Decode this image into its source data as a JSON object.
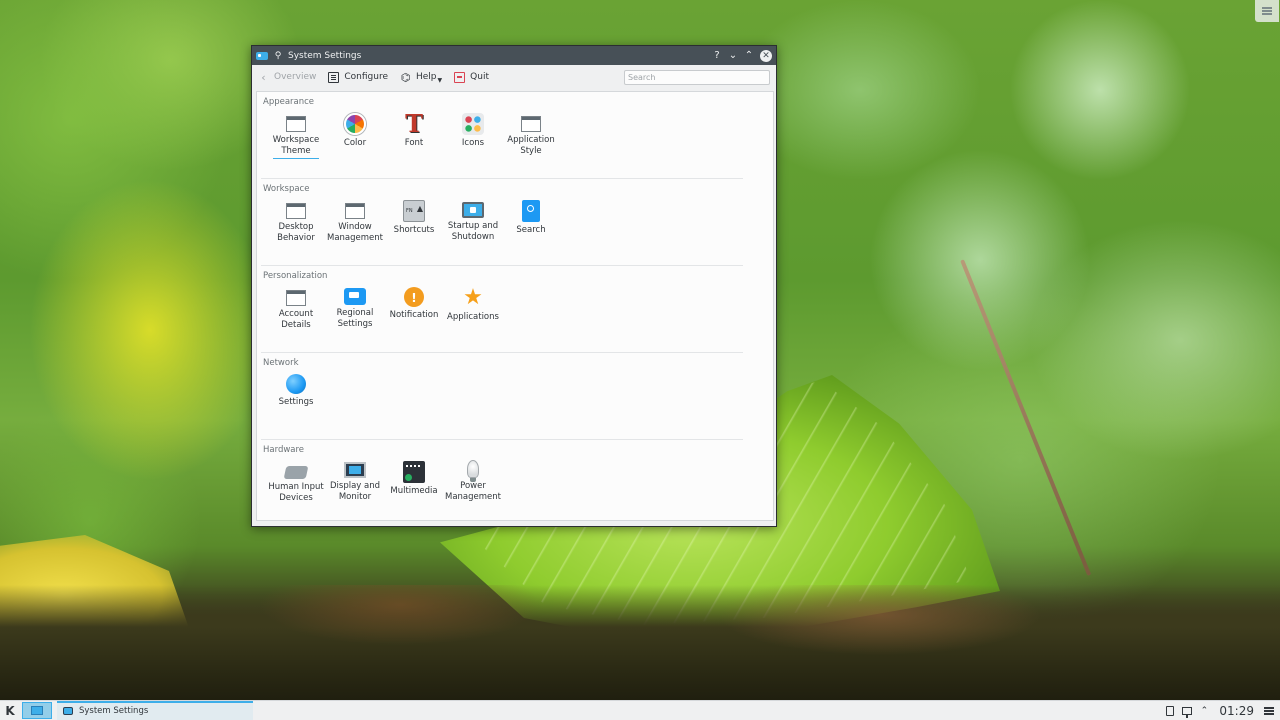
{
  "window": {
    "title": "System Settings",
    "buttons": {
      "help": "?",
      "minimize": "⌄",
      "maximize": "⌃",
      "close": "✕"
    }
  },
  "toolbar": {
    "overview_label": "Overview",
    "configure_label": "Configure",
    "help_label": "Help",
    "quit_label": "Quit",
    "search_placeholder": "Search"
  },
  "categories": [
    {
      "title": "Appearance",
      "items": [
        {
          "label": "Workspace\nTheme",
          "icon": "window-icon",
          "selected": true
        },
        {
          "label": "Color",
          "icon": "color-wheel-icon"
        },
        {
          "label": "Font",
          "icon": "font-icon",
          "glyph": "T"
        },
        {
          "label": "Icons",
          "icon": "icons-icon"
        },
        {
          "label": "Application\nStyle",
          "icon": "window-icon"
        }
      ]
    },
    {
      "title": "Workspace",
      "items": [
        {
          "label": "Desktop\nBehavior",
          "icon": "window-icon"
        },
        {
          "label": "Window\nManagement",
          "icon": "window-icon"
        },
        {
          "label": "Shortcuts",
          "icon": "keyboard-key-icon",
          "glyph": "FN"
        },
        {
          "label": "Startup and\nShutdown",
          "icon": "monitor-icon"
        },
        {
          "label": "Search",
          "icon": "search-icon"
        }
      ]
    },
    {
      "title": "Personalization",
      "items": [
        {
          "label": "Account\nDetails",
          "icon": "window-icon"
        },
        {
          "label": "Regional\nSettings",
          "icon": "chat-bubble-icon"
        },
        {
          "label": "Notification",
          "icon": "notification-icon",
          "glyph": "!"
        },
        {
          "label": "Applications",
          "icon": "star-icon",
          "glyph": "★"
        }
      ]
    },
    {
      "title": "Network",
      "items": [
        {
          "label": "Settings",
          "icon": "globe-icon"
        }
      ]
    },
    {
      "title": "Hardware",
      "items": [
        {
          "label": "Human Input\nDevices",
          "icon": "keyboard-icon"
        },
        {
          "label": "Display and\nMonitor",
          "icon": "display-icon"
        },
        {
          "label": "Multimedia",
          "icon": "multimedia-icon"
        },
        {
          "label": "Power\nManagement",
          "icon": "lightbulb-icon"
        }
      ]
    }
  ],
  "taskbar": {
    "task_label": "System Settings",
    "clock": "01:29"
  },
  "colors": {
    "accent": "#3daee9",
    "titlebar": "#475057",
    "window_bg": "#eff0f1"
  }
}
